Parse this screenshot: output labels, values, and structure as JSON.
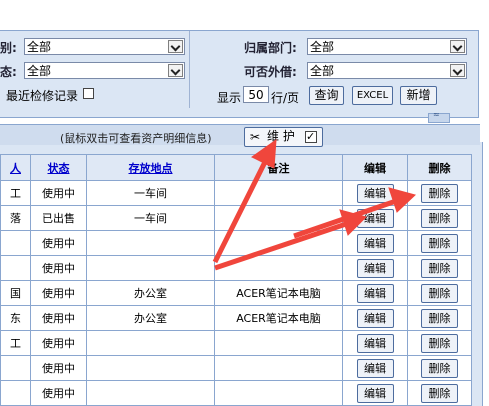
{
  "filters": {
    "category_label": "别:",
    "category_value": "全部",
    "dept_label": "归属部门:",
    "dept_value": "全部",
    "status_label": "态:",
    "status_value": "全部",
    "lend_label": "可否外借:",
    "lend_value": "全部",
    "recent_check_label": "最近检修记录",
    "display_label": "显示",
    "page_size": "50",
    "per_page_label": "行/页",
    "query_button": "查询",
    "excel_button": "EXCEL",
    "add_button": "新增"
  },
  "hint": "(鼠标双击可查看资产明细信息)",
  "maintain_label": "维 护",
  "table": {
    "headers": {
      "col0": "人",
      "status": "状态",
      "location": "存放地点",
      "remark": "备注",
      "edit": "编辑",
      "delete": "删除"
    },
    "edit_label": "编辑",
    "delete_label": "删除",
    "rows": [
      {
        "c0": "工",
        "status": "使用中",
        "location": "一车间",
        "remark": ""
      },
      {
        "c0": "落",
        "status": "已出售",
        "location": "一车间",
        "remark": ""
      },
      {
        "c0": "",
        "status": "使用中",
        "location": "",
        "remark": ""
      },
      {
        "c0": "",
        "status": "使用中",
        "location": "",
        "remark": ""
      },
      {
        "c0": "国",
        "status": "使用中",
        "location": "办公室",
        "remark": "ACER笔记本电脑"
      },
      {
        "c0": "东",
        "status": "使用中",
        "location": "办公室",
        "remark": "ACER笔记本电脑"
      },
      {
        "c0": "工",
        "status": "使用中",
        "location": "",
        "remark": ""
      },
      {
        "c0": "",
        "status": "使用中",
        "location": "",
        "remark": ""
      },
      {
        "c0": "",
        "status": "使用中",
        "location": "",
        "remark": ""
      }
    ]
  },
  "colors": {
    "panel_bg": "#dbe6f4",
    "border": "#8aa6cf",
    "arrow": "#f0463c",
    "link": "#0000cc"
  }
}
